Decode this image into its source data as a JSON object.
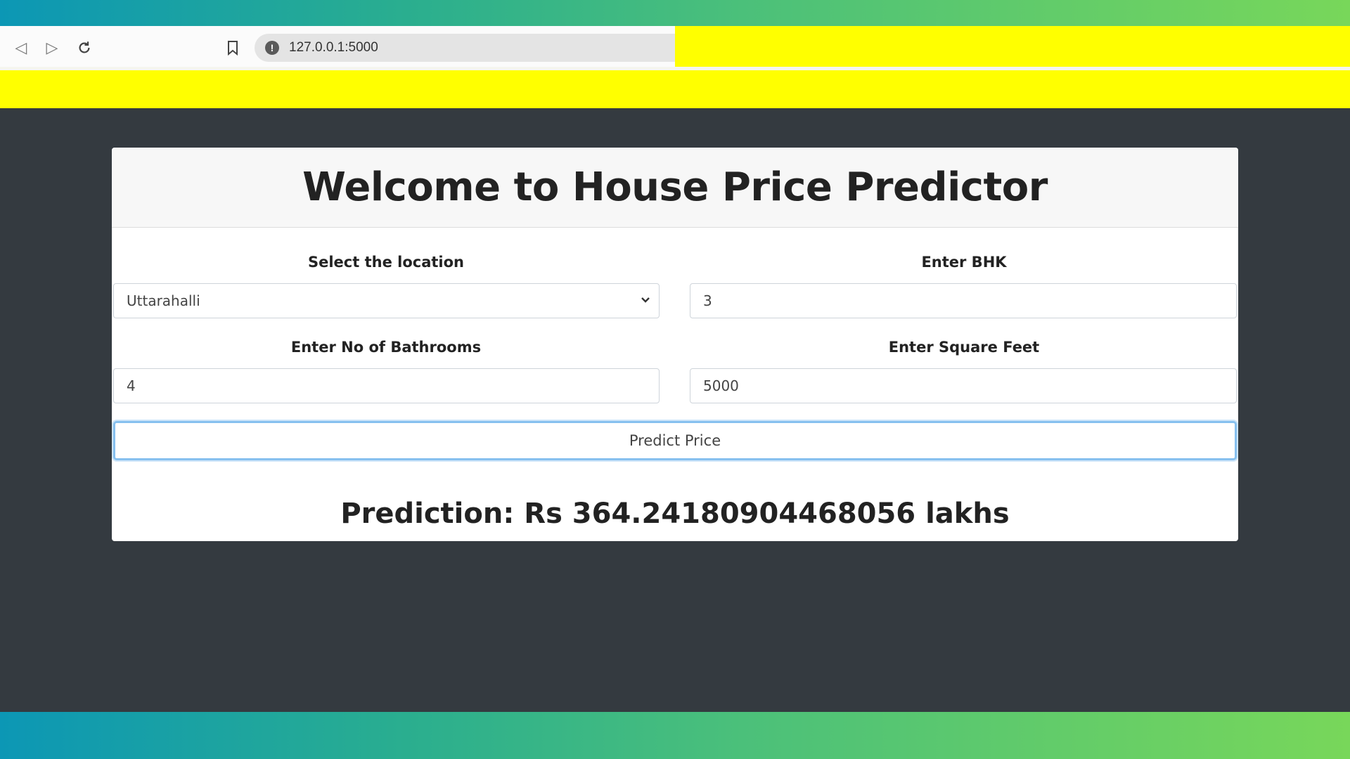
{
  "browser": {
    "url": "127.0.0.1:5000",
    "back_icon": "back-icon",
    "forward_icon": "forward-icon",
    "reload_icon": "reload-icon",
    "bookmark_icon": "bookmark-icon",
    "info_icon": "info-icon"
  },
  "page": {
    "title": "Welcome to House Price Predictor",
    "location_label": "Select the location",
    "location_value": "Uttarahalli",
    "bhk_label": "Enter BHK",
    "bhk_value": "3",
    "bathrooms_label": "Enter No of Bathrooms",
    "bathrooms_value": "4",
    "sqft_label": "Enter Square Feet",
    "sqft_value": "5000",
    "predict_button": "Predict Price",
    "prediction_text": "Prediction: Rs 364.24180904468056 lakhs"
  },
  "colors": {
    "background": "#343a40",
    "highlight": "#ffff00",
    "focus_ring": "#86c0ef"
  }
}
